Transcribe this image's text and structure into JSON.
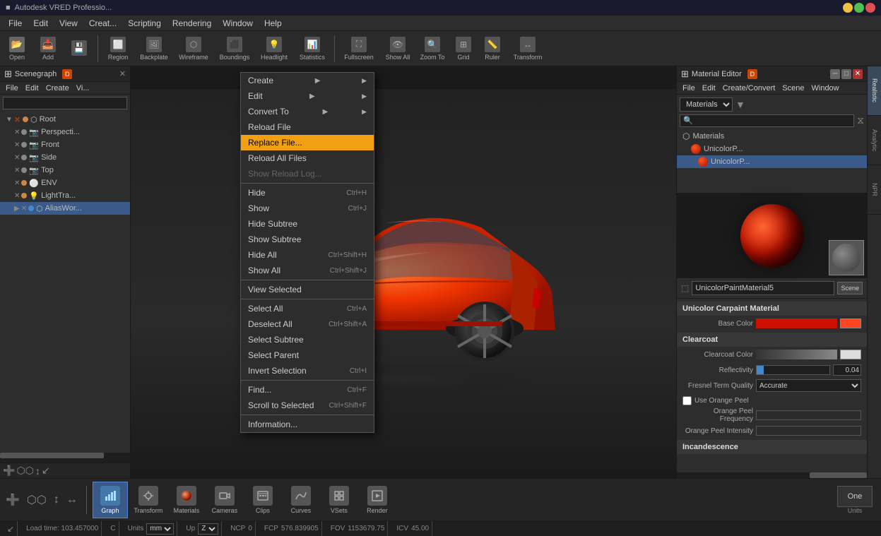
{
  "app": {
    "title": "Autodesk VRED Professio...",
    "titlebar_buttons": [
      "minimize",
      "maximize",
      "close"
    ]
  },
  "top_menubar": {
    "items": [
      "File",
      "Edit",
      "View",
      "Creat...",
      "Scripting",
      "Rendering",
      "Window",
      "Help"
    ]
  },
  "toolbar": {
    "buttons": [
      {
        "label": "Open",
        "icon": "folder-icon"
      },
      {
        "label": "Add",
        "icon": "add-icon"
      },
      {
        "label": "",
        "icon": "save-icon"
      }
    ]
  },
  "viewport_toolbar": {
    "buttons": [
      "Region",
      "Backplate",
      "Wireframe",
      "Boundings",
      "Headlight",
      "Statistics",
      "Fullscreen",
      "Show All",
      "Zoom To",
      "Grid",
      "Ruler",
      "Transform"
    ]
  },
  "scenegraph": {
    "title": "Scenegraph",
    "badge": "D",
    "menubar": [
      "File",
      "Edit",
      "Create",
      "Vi..."
    ],
    "search_placeholder": "",
    "tree": [
      {
        "label": "Root",
        "level": 0,
        "icon": "cube",
        "color": "blue",
        "expanded": true,
        "has_x": false
      },
      {
        "label": "Perspecti...",
        "level": 1,
        "icon": "camera",
        "color": "gray",
        "has_x": true
      },
      {
        "label": "Front",
        "level": 1,
        "icon": "camera",
        "color": "gray",
        "has_x": true
      },
      {
        "label": "Side",
        "level": 1,
        "icon": "camera",
        "color": "gray",
        "has_x": true
      },
      {
        "label": "Top",
        "level": 1,
        "icon": "camera",
        "color": "gray",
        "has_x": true
      },
      {
        "label": "ENV",
        "level": 1,
        "icon": "sphere",
        "color": "orange",
        "has_x": true
      },
      {
        "label": "LightTra...",
        "level": 1,
        "icon": "light",
        "color": "orange",
        "has_x": true
      },
      {
        "label": "AliasWor...",
        "level": 1,
        "icon": "group",
        "color": "blue",
        "has_x": true
      }
    ]
  },
  "context_menu": {
    "items": [
      {
        "label": "Create",
        "shortcut": "",
        "arrow": true,
        "type": "normal"
      },
      {
        "label": "Edit",
        "shortcut": "",
        "arrow": true,
        "type": "normal"
      },
      {
        "label": "Convert To",
        "shortcut": "",
        "arrow": true,
        "type": "normal"
      },
      {
        "label": "Reload File",
        "shortcut": "",
        "type": "normal"
      },
      {
        "label": "Replace File...",
        "shortcut": "",
        "type": "highlighted"
      },
      {
        "label": "Reload All Files",
        "shortcut": "",
        "type": "normal"
      },
      {
        "label": "Show Reload Log...",
        "shortcut": "",
        "type": "disabled"
      },
      {
        "label": "sep1",
        "type": "separator"
      },
      {
        "label": "Hide",
        "shortcut": "Ctrl+H",
        "type": "normal"
      },
      {
        "label": "Show",
        "shortcut": "Ctrl+J",
        "type": "normal"
      },
      {
        "label": "Hide Subtree",
        "shortcut": "",
        "type": "normal"
      },
      {
        "label": "Show Subtree",
        "shortcut": "",
        "type": "normal"
      },
      {
        "label": "Hide All",
        "shortcut": "Ctrl+Shift+H",
        "type": "normal"
      },
      {
        "label": "Show All",
        "shortcut": "Ctrl+Shift+J",
        "type": "normal"
      },
      {
        "label": "sep2",
        "type": "separator"
      },
      {
        "label": "View Selected",
        "shortcut": "",
        "type": "normal"
      },
      {
        "label": "sep3",
        "type": "separator"
      },
      {
        "label": "Select All",
        "shortcut": "Ctrl+A",
        "type": "normal"
      },
      {
        "label": "Deselect All",
        "shortcut": "Ctrl+Shift+A",
        "type": "normal"
      },
      {
        "label": "Select Subtree",
        "shortcut": "",
        "type": "normal"
      },
      {
        "label": "Select Parent",
        "shortcut": "",
        "type": "normal"
      },
      {
        "label": "Invert Selection",
        "shortcut": "Ctrl+I",
        "type": "normal"
      },
      {
        "label": "sep4",
        "type": "separator"
      },
      {
        "label": "Find...",
        "shortcut": "Ctrl+F",
        "type": "normal"
      },
      {
        "label": "Scroll to Selected",
        "shortcut": "Ctrl+Shift+F",
        "type": "normal"
      },
      {
        "label": "sep5",
        "type": "separator"
      },
      {
        "label": "Information...",
        "shortcut": "",
        "type": "normal"
      }
    ]
  },
  "material_editor": {
    "title": "Material Editor",
    "badge": "D",
    "menubar": [
      "File",
      "Edit",
      "Create/Convert",
      "Scene",
      "Window"
    ],
    "dropdown_value": "Materials",
    "material_name": "UnicolorPaintMaterial5",
    "scene_button": "Scene",
    "tree": [
      {
        "label": "Materials",
        "level": 0,
        "icon": "folder",
        "expanded": true
      },
      {
        "label": "UnicolorP...",
        "level": 1,
        "icon": "material"
      },
      {
        "label": "UnicolorP...",
        "level": 2,
        "icon": "material"
      }
    ],
    "section_title": "Unicolor Carpaint Material",
    "clearcoat_title": "Clearcoat",
    "incandescence_title": "Incandescence",
    "base_color_label": "Base Color",
    "clearcoat_color_label": "Clearcoat Color",
    "reflectivity_label": "Reflectivity",
    "reflectivity_value": "0.04",
    "fresnel_label": "Fresnel Term Quality",
    "fresnel_value": "Accurate",
    "orange_peel_freq_label": "Orange Peel Frequency",
    "orange_peel_int_label": "Orange Peel Intensity",
    "use_orange_peel_label": "Use Orange Peel",
    "vertical_tabs": [
      "Realistic",
      "Analytic",
      "NPR"
    ]
  },
  "bottom_toolbar": {
    "buttons": [
      {
        "label": "Graph",
        "icon": "graph-icon",
        "active": true
      },
      {
        "label": "Transform",
        "icon": "transform-icon",
        "active": false
      },
      {
        "label": "Materials",
        "icon": "materials-icon",
        "active": false
      },
      {
        "label": "Cameras",
        "icon": "cameras-icon",
        "active": false
      },
      {
        "label": "Clips",
        "icon": "clips-icon",
        "active": false
      },
      {
        "label": "Curves",
        "icon": "curves-icon",
        "active": false
      },
      {
        "label": "VSets",
        "icon": "vsets-icon",
        "active": false
      },
      {
        "label": "Render",
        "icon": "render-icon",
        "active": false
      }
    ]
  },
  "statusbar": {
    "left_icon": "arrow-icon",
    "load_time": "Load time: 103.457000",
    "c_label": "C",
    "units_label": "Units",
    "units_value": "mm",
    "up_label": "Up",
    "up_value": "Z",
    "ncp_label": "NCP",
    "ncp_value": "0",
    "fcp_label": "FCP",
    "fcp_value": "576.839905",
    "fov_label": "FOV",
    "fov_value": "1153679.75",
    "icv_label": "ICV",
    "icv_value": "45.00",
    "one_label": "One",
    "units_bottom": "Units"
  }
}
